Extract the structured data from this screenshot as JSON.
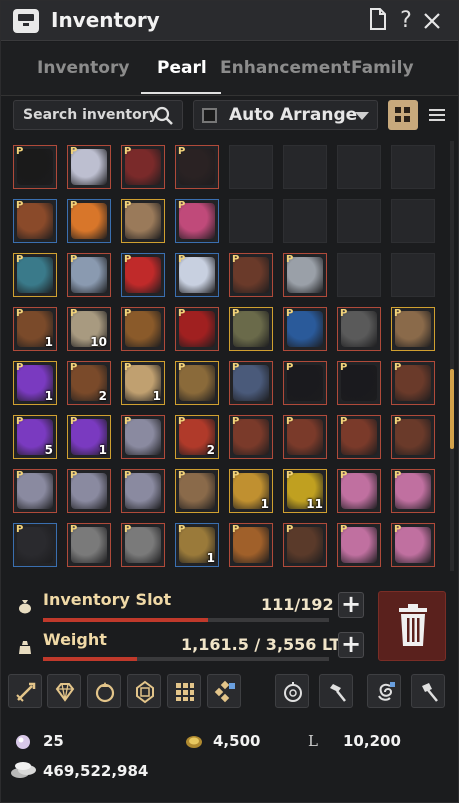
{
  "window": {
    "title": "Inventory"
  },
  "tabs": [
    {
      "label": "Inventory"
    },
    {
      "label": "Pearl"
    },
    {
      "label": "Enhancement"
    },
    {
      "label": "Family"
    }
  ],
  "search": {
    "placeholder": "Search inventory"
  },
  "arrange": {
    "label": "Auto Arrange",
    "checked": false
  },
  "view_mode": "grid",
  "grid": {
    "slots": [
      {
        "name": "cat-ears-headband",
        "count": "",
        "pearl": true,
        "c": "#1a1a1a",
        "b": "#b04a3a"
      },
      {
        "name": "demon-mask",
        "count": "",
        "pearl": true,
        "c": "#bdbfd0",
        "b": "#b04a3a"
      },
      {
        "name": "round-sunglasses",
        "count": "",
        "pearl": true,
        "c": "#7a2a2a",
        "b": "#b04a3a"
      },
      {
        "name": "black-scarf",
        "count": "",
        "pearl": true,
        "c": "#2a2223",
        "b": "#b04a3a"
      },
      {
        "name": "empty",
        "count": "",
        "pearl": false
      },
      {
        "name": "empty",
        "count": "",
        "pearl": false
      },
      {
        "name": "empty",
        "count": "",
        "pearl": false
      },
      {
        "name": "empty",
        "count": "",
        "pearl": false
      },
      {
        "name": "reindeer-antlers",
        "count": "",
        "pearl": true,
        "c": "#8a4a2a",
        "b": "#3a6fb0"
      },
      {
        "name": "pumpkin-head",
        "count": "",
        "pearl": true,
        "c": "#d8762a",
        "b": "#3a6fb0"
      },
      {
        "name": "rabbit-mask",
        "count": "",
        "pearl": true,
        "c": "#9a7a5a",
        "b": "#d0a030"
      },
      {
        "name": "pink-teapot",
        "count": "",
        "pearl": true,
        "c": "#c04a7a",
        "b": "#3a6fb0"
      },
      {
        "name": "empty",
        "count": "",
        "pearl": false
      },
      {
        "name": "empty",
        "count": "",
        "pearl": false
      },
      {
        "name": "empty",
        "count": "",
        "pearl": false
      },
      {
        "name": "empty",
        "count": "",
        "pearl": false
      },
      {
        "name": "teal-knight-helm",
        "count": "",
        "pearl": true,
        "c": "#3a7a8a",
        "b": "#d0a030"
      },
      {
        "name": "glasses-case",
        "count": "",
        "pearl": true,
        "c": "#8a9ab0",
        "b": "#b04a3a"
      },
      {
        "name": "santa-hat",
        "count": "",
        "pearl": true,
        "c": "#c02a2a",
        "b": "#3a6fb0"
      },
      {
        "name": "snowman-head",
        "count": "",
        "pearl": true,
        "c": "#c8d0e0",
        "b": "#3a6fb0"
      },
      {
        "name": "brown-glasses",
        "count": "",
        "pearl": true,
        "c": "#6a3a2a",
        "b": "#b04a3a"
      },
      {
        "name": "silver-glasses",
        "count": "",
        "pearl": true,
        "c": "#9aa0a8",
        "b": "#b04a3a"
      },
      {
        "name": "empty",
        "count": "",
        "pearl": false
      },
      {
        "name": "empty",
        "count": "",
        "pearl": false
      },
      {
        "name": "leather-book",
        "count": "1",
        "pearl": true,
        "c": "#7a4a2a",
        "b": "#b04a3a"
      },
      {
        "name": "paper-scroll",
        "count": "10",
        "pearl": true,
        "c": "#a89a80",
        "b": "#b04a3a"
      },
      {
        "name": "lion-mask",
        "count": "",
        "pearl": true,
        "c": "#8a5a2a",
        "b": "#b04a3a"
      },
      {
        "name": "red-coupon",
        "count": "",
        "pearl": true,
        "c": "#a02020",
        "b": "#b04a3a"
      },
      {
        "name": "scarecrow-hat",
        "count": "",
        "pearl": true,
        "c": "#6a6a4a",
        "b": "#d0a030"
      },
      {
        "name": "blue-dragon-pet",
        "count": "",
        "pearl": true,
        "c": "#2a5a9a",
        "b": "#b04a3a"
      },
      {
        "name": "key-chain",
        "count": "",
        "pearl": true,
        "c": "#5a5a5a",
        "b": "#b04a3a"
      },
      {
        "name": "festival-box",
        "count": "",
        "pearl": true,
        "c": "#8a6a4a",
        "b": "#d0a030"
      },
      {
        "name": "purple-chest",
        "count": "1",
        "pearl": true,
        "c": "#7a3ac0",
        "b": "#d0a030"
      },
      {
        "name": "leather-book",
        "count": "2",
        "pearl": true,
        "c": "#7a4a2a",
        "b": "#b04a3a"
      },
      {
        "name": "pearl-scroll",
        "count": "1",
        "pearl": true,
        "c": "#c0a070",
        "b": "#d0a030"
      },
      {
        "name": "spear-scroll",
        "count": "",
        "pearl": true,
        "c": "#8a6a3a",
        "b": "#d0a030"
      },
      {
        "name": "star-box",
        "count": "",
        "pearl": true,
        "c": "#4a5a7a",
        "b": "#b04a3a"
      },
      {
        "name": "black-claw",
        "count": "",
        "pearl": true,
        "c": "#1a1a1e",
        "b": "#b04a3a"
      },
      {
        "name": "black-claw",
        "count": "",
        "pearl": true,
        "c": "#1a1a1e",
        "b": "#b04a3a"
      },
      {
        "name": "treasure-chest-dark",
        "count": "",
        "pearl": true,
        "c": "#6a3a2a",
        "b": "#b04a3a"
      },
      {
        "name": "purple-chest",
        "count": "5",
        "pearl": true,
        "c": "#7a3ac0",
        "b": "#d0a030"
      },
      {
        "name": "purple-chest",
        "count": "1",
        "pearl": true,
        "c": "#7a3ac0",
        "b": "#d0a030"
      },
      {
        "name": "silver-stars",
        "count": "",
        "pearl": true,
        "c": "#8a8aa0",
        "b": "#b04a3a"
      },
      {
        "name": "red-statue",
        "count": "2",
        "pearl": true,
        "c": "#b03a2a",
        "b": "#d0a030"
      },
      {
        "name": "treasure-chest-red",
        "count": "",
        "pearl": true,
        "c": "#7a3a2a",
        "b": "#b04a3a"
      },
      {
        "name": "treasure-chest-red",
        "count": "",
        "pearl": true,
        "c": "#7a3a2a",
        "b": "#b04a3a"
      },
      {
        "name": "treasure-chest-red",
        "count": "",
        "pearl": true,
        "c": "#7a3a2a",
        "b": "#b04a3a"
      },
      {
        "name": "treasure-chest-dark",
        "count": "",
        "pearl": true,
        "c": "#6a3a2a",
        "b": "#b04a3a"
      },
      {
        "name": "silver-stars",
        "count": "",
        "pearl": true,
        "c": "#8a8aa0",
        "b": "#b04a3a"
      },
      {
        "name": "silver-stars",
        "count": "",
        "pearl": true,
        "c": "#8a8aa0",
        "b": "#b04a3a"
      },
      {
        "name": "silver-stars",
        "count": "",
        "pearl": true,
        "c": "#8a8aa0",
        "b": "#b04a3a"
      },
      {
        "name": "eagle-statue",
        "count": "",
        "pearl": true,
        "c": "#8a6a4a",
        "b": "#d0a030"
      },
      {
        "name": "golden-trophy",
        "count": "1",
        "pearl": true,
        "c": "#c09030",
        "b": "#d0a030"
      },
      {
        "name": "golden-butterfly",
        "count": "11",
        "pearl": true,
        "c": "#c0a020",
        "b": "#d0a030"
      },
      {
        "name": "pink-blossom",
        "count": "",
        "pearl": true,
        "c": "#c070a0",
        "b": "#b04a3a"
      },
      {
        "name": "pink-blossom",
        "count": "",
        "pearl": true,
        "c": "#c070a0",
        "b": "#b04a3a"
      },
      {
        "name": "black-box",
        "count": "",
        "pearl": true,
        "c": "#2a2a2e",
        "b": "#3a6fb0"
      },
      {
        "name": "stone-eagle",
        "count": "",
        "pearl": true,
        "c": "#7a7a7a",
        "b": "#b04a3a"
      },
      {
        "name": "stone-eagle",
        "count": "",
        "pearl": true,
        "c": "#7a7a7a",
        "b": "#b04a3a"
      },
      {
        "name": "compass",
        "count": "1",
        "pearl": true,
        "c": "#9a7a3a",
        "b": "#3a6fb0"
      },
      {
        "name": "golden-chest",
        "count": "",
        "pearl": true,
        "c": "#a0602a",
        "b": "#b04a3a"
      },
      {
        "name": "dark-bag",
        "count": "",
        "pearl": true,
        "c": "#5a3a2a",
        "b": "#b04a3a"
      },
      {
        "name": "pink-blossom",
        "count": "",
        "pearl": true,
        "c": "#c070a0",
        "b": "#b04a3a"
      },
      {
        "name": "pink-blossom",
        "count": "",
        "pearl": true,
        "c": "#c070a0",
        "b": "#b04a3a"
      }
    ],
    "scroll_fraction": 0.55
  },
  "inventory_slot": {
    "label": "Inventory Slot",
    "value": "111/192",
    "fraction": 0.578
  },
  "weight": {
    "label": "Weight",
    "value": "1,161.5 / 3,556 LT",
    "fraction": 0.327
  },
  "tools": [
    {
      "icon": "sword-enhance-icon"
    },
    {
      "icon": "diamond-icon"
    },
    {
      "icon": "crystal-ring-icon"
    },
    {
      "icon": "gem-icon"
    },
    {
      "icon": "grid-icon"
    },
    {
      "icon": "cube-icon"
    },
    {
      "icon": "compass-icon"
    },
    {
      "icon": "hammer-icon"
    },
    {
      "icon": "swirl-icon"
    },
    {
      "icon": "mallet-icon"
    }
  ],
  "currency": {
    "pearls": "25",
    "coins": "4,500",
    "loyalty_symbol": "L",
    "loyalty": "10,200",
    "silver": "469,522,984"
  },
  "colors": {
    "accent": "#d4a24a",
    "danger": "#c0392b",
    "trash": "#5a211d"
  }
}
